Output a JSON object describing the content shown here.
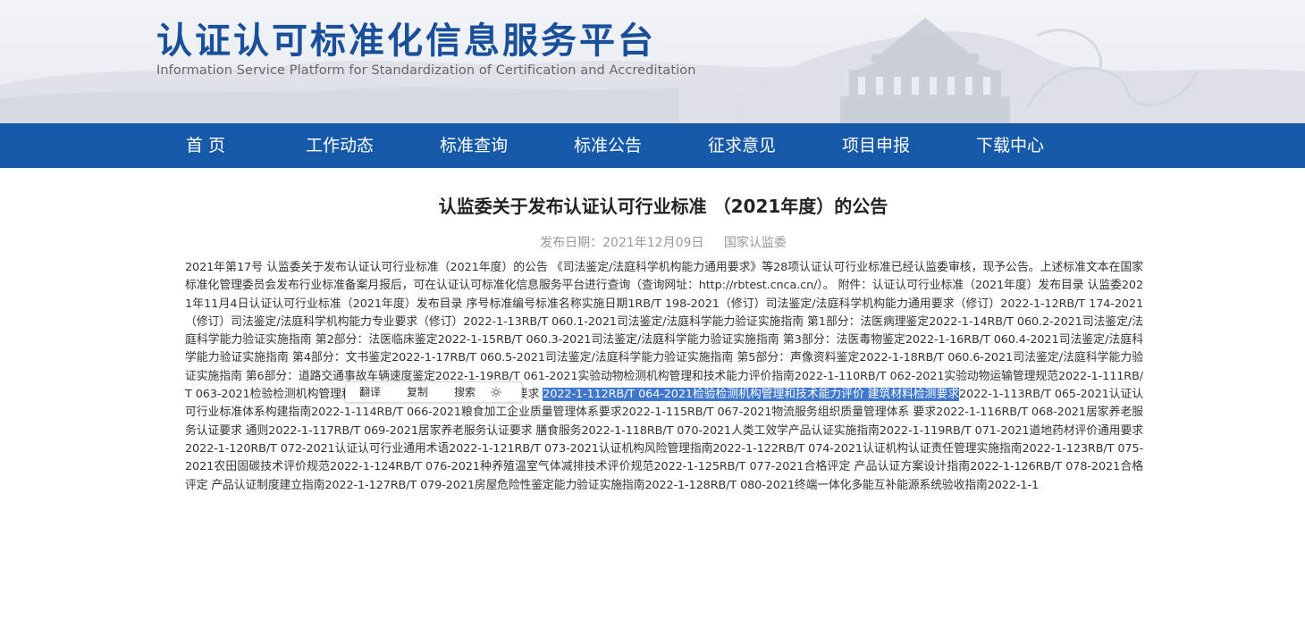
{
  "site": {
    "title": "认证认可标准化信息服务平台",
    "subtitle": "Information Service Platform for Standardization of Certification and Accreditation"
  },
  "nav": [
    {
      "label": "首 页"
    },
    {
      "label": "工作动态"
    },
    {
      "label": "标准查询"
    },
    {
      "label": "标准公告"
    },
    {
      "label": "征求意见"
    },
    {
      "label": "项目申报"
    },
    {
      "label": "下载中心"
    }
  ],
  "article": {
    "title": "认监委关于发布认证认可行业标准 （2021年度）的公告",
    "date": "发布日期：2021年12月09日",
    "source": "国家认监委",
    "body_before": "2021年第17号 认监委关于发布认证认可行业标准（2021年度）的公告 《司法鉴定/法庭科学机构能力通用要求》等28项认证认可行业标准已经认监委审核，现予公告。上述标准文本在国家标准化管理委员会发布行业标准备案月报后，可在认证认可标准化信息服务平台进行查询（查询网址：http://rbtest.cnca.cn/）。 附件：认证认可行业标准（2021年度）发布目录 认监委2021年11月4日认证认可行业标准（2021年度）发布目录 序号标准编号标准名称实施日期1RB/T 198-2021（修订）司法鉴定/法庭科学机构能力通用要求（修订）2022-1-12RB/T 174-2021（修订）司法鉴定/法庭科学机构能力专业要求（修订）2022-1-13RB/T 060.1-2021司法鉴定/法庭科学能力验证实施指南 第1部分：法医病理鉴定2022-1-14RB/T 060.2-2021司法鉴定/法庭科学能力验证实施指南 第2部分：法医临床鉴定2022-1-15RB/T 060.3-2021司法鉴定/法庭科学能力验证实施指南 第3部分：法医毒物鉴定2022-1-16RB/T 060.4-2021司法鉴定/法庭科学能力验证实施指南 第4部分：文书鉴定2022-1-17RB/T 060.5-2021司法鉴定/法庭科学能力验证实施指南 第5部分：声像资料鉴定2022-1-18RB/T 060.6-2021司法鉴定/法庭科学能力验证实施指南 第6部分：道路交通事故车辆速度鉴定2022-1-19RB/T 061-2021实验动物检测机构管理和技术能力评价指南2022-1-110RB/T 062-2021实验动物运输管理规范2022-1-111RB/T 063-2021检验检测机构管理和技术能力评价 方法的验证和确认要求 ",
    "body_selected": "2022-1-112RB/T 064-2021检验检测机构管理和技术能力评价 建筑材料检测要求",
    "body_after": "2022-1-113RB/T 065-2021认证认可行业标准体系构建指南2022-1-114RB/T 066-2021粮食加工企业质量管理体系要求2022-1-115RB/T 067-2021物流服务组织质量管理体系 要求2022-1-116RB/T 068-2021居家养老服务认证要求 通则2022-1-117RB/T 069-2021居家养老服务认证要求 膳食服务2022-1-118RB/T 070-2021人类工效学产品认证实施指南2022-1-119RB/T 071-2021道地药材评价通用要求2022-1-120RB/T 072-2021认证认可行业通用术语2022-1-121RB/T 073-2021认证机构风险管理指南2022-1-122RB/T 074-2021认证机构认证责任管理实施指南2022-1-123RB/T 075-2021农田固碳技术评价规范2022-1-124RB/T 076-2021种养殖温室气体减排技术评价规范2022-1-125RB/T 077-2021合格评定 产品认证方案设计指南2022-1-126RB/T 078-2021合格评定 产品认证制度建立指南2022-1-127RB/T 079-2021房屋危险性鉴定能力验证实施指南2022-1-128RB/T 080-2021终端一体化多能互补能源系统验收指南2022-1-1"
  },
  "context_menu": {
    "translate": "翻译",
    "copy": "复制",
    "search": "搜索",
    "settings_icon": "gear-icon"
  },
  "colors": {
    "brand": "#1a4f9a",
    "nav_bg": "#1559a8",
    "selection": "#3f78cc"
  }
}
